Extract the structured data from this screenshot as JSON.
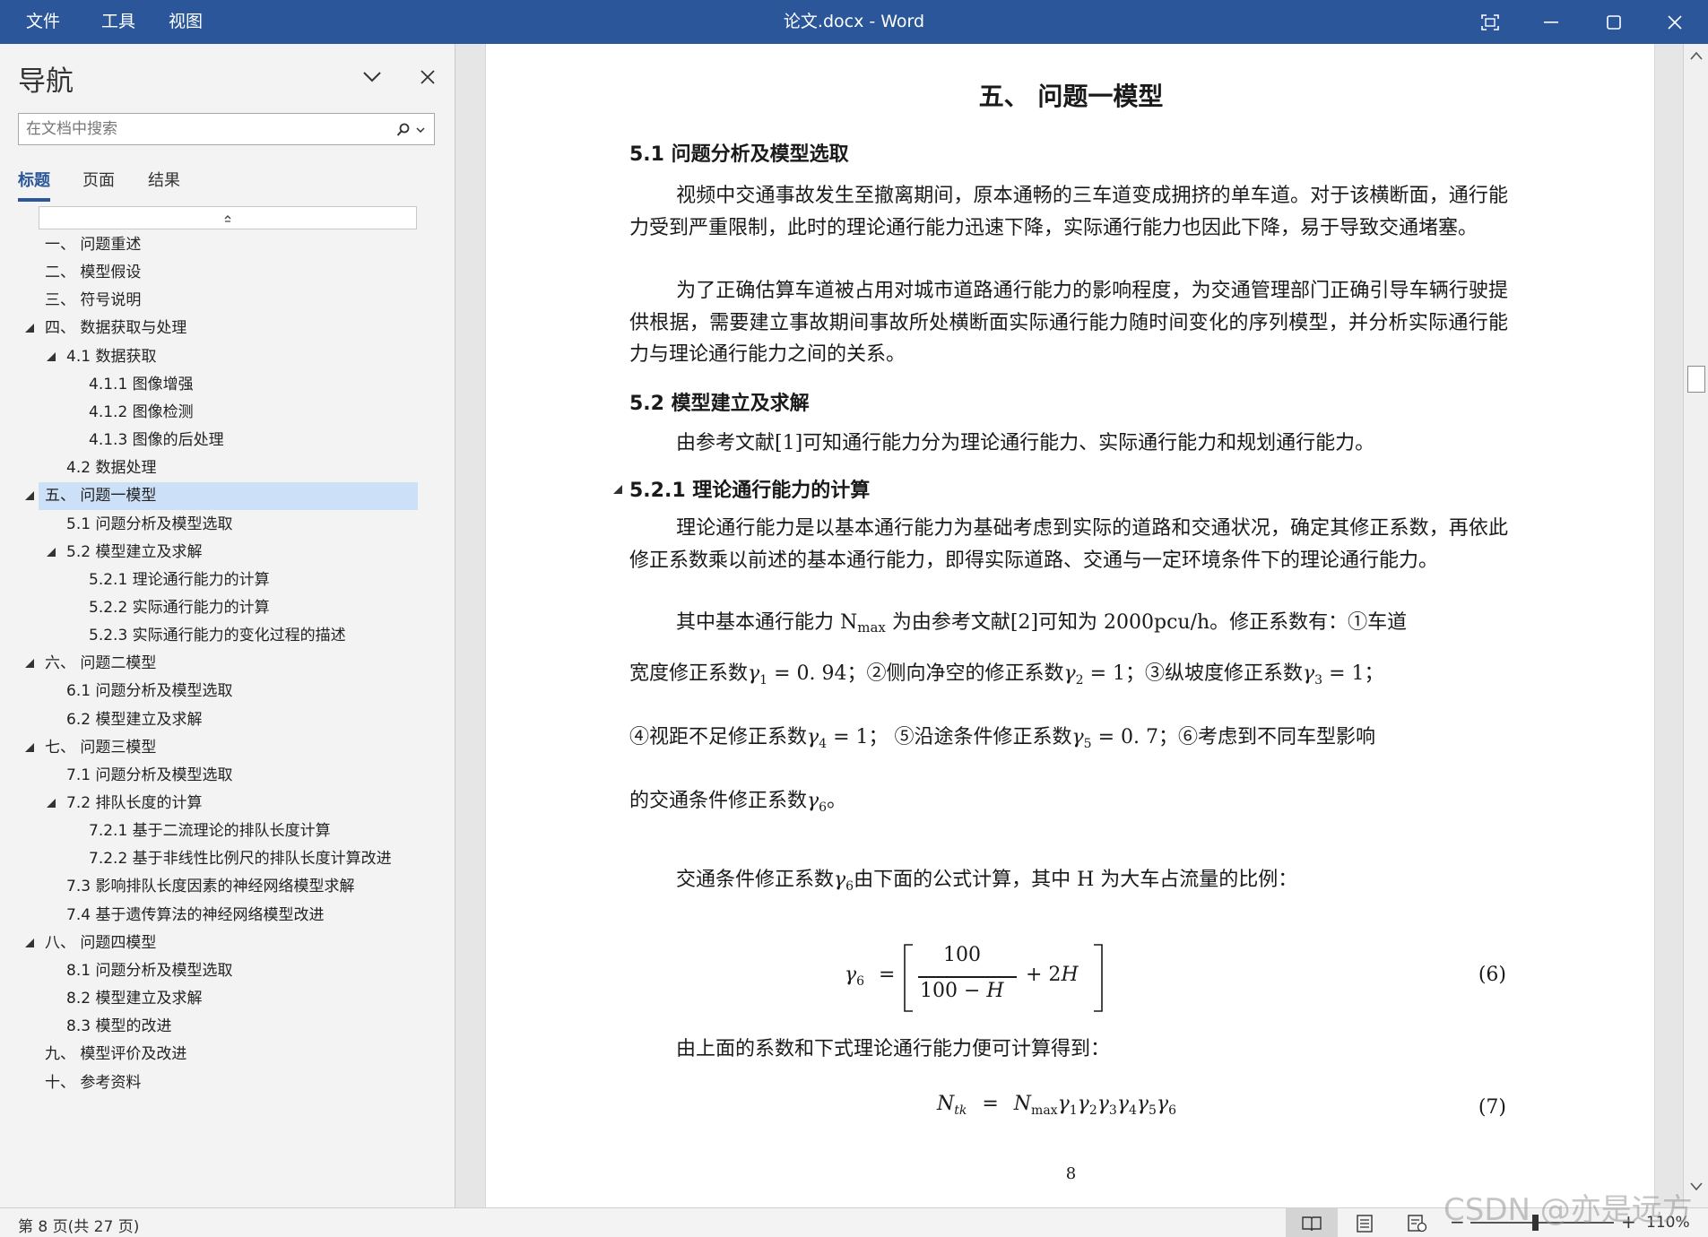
{
  "titlebar": {
    "menu": [
      "文件",
      "工具",
      "视图"
    ],
    "doc_title": "论文.docx - Word"
  },
  "nav": {
    "title": "导航",
    "search_placeholder": "在文档中搜索",
    "tabs": [
      "标题",
      "页面",
      "结果"
    ],
    "active_tab": "标题",
    "headings": [
      {
        "label": "一、 问题重述",
        "level": 1,
        "expandable": false
      },
      {
        "label": "二、 模型假设",
        "level": 1,
        "expandable": false
      },
      {
        "label": "三、 符号说明",
        "level": 1,
        "expandable": false
      },
      {
        "label": "四、 数据获取与处理",
        "level": 1,
        "expandable": true
      },
      {
        "label": "4.1 数据获取",
        "level": 2,
        "expandable": true
      },
      {
        "label": "4.1.1 图像增强",
        "level": 3,
        "expandable": false
      },
      {
        "label": "4.1.2 图像检测",
        "level": 3,
        "expandable": false
      },
      {
        "label": "4.1.3 图像的后处理",
        "level": 3,
        "expandable": false
      },
      {
        "label": "4.2 数据处理",
        "level": 2,
        "expandable": false
      },
      {
        "label": "五、 问题一模型",
        "level": 1,
        "expandable": true,
        "selected": true
      },
      {
        "label": "5.1 问题分析及模型选取",
        "level": 2,
        "expandable": false
      },
      {
        "label": "5.2 模型建立及求解",
        "level": 2,
        "expandable": true
      },
      {
        "label": "5.2.1 理论通行能力的计算",
        "level": 3,
        "expandable": false
      },
      {
        "label": "5.2.2 实际通行能力的计算",
        "level": 3,
        "expandable": false
      },
      {
        "label": "5.2.3 实际通行能力的变化过程的描述",
        "level": 3,
        "expandable": false
      },
      {
        "label": "六、 问题二模型",
        "level": 1,
        "expandable": true
      },
      {
        "label": "6.1 问题分析及模型选取",
        "level": 2,
        "expandable": false
      },
      {
        "label": "6.2 模型建立及求解",
        "level": 2,
        "expandable": false
      },
      {
        "label": "七、 问题三模型",
        "level": 1,
        "expandable": true
      },
      {
        "label": "7.1 问题分析及模型选取",
        "level": 2,
        "expandable": false
      },
      {
        "label": "7.2 排队长度的计算",
        "level": 2,
        "expandable": true
      },
      {
        "label": "7.2.1 基于二流理论的排队长度计算",
        "level": 3,
        "expandable": false
      },
      {
        "label": "7.2.2 基于非线性比例尺的排队长度计算改进",
        "level": 3,
        "expandable": false
      },
      {
        "label": "7.3 影响排队长度因素的神经网络模型求解",
        "level": 2,
        "expandable": false
      },
      {
        "label": "7.4 基于遗传算法的神经网络模型改进",
        "level": 2,
        "expandable": false
      },
      {
        "label": "八、 问题四模型",
        "level": 1,
        "expandable": true
      },
      {
        "label": "8.1 问题分析及模型选取",
        "level": 2,
        "expandable": false
      },
      {
        "label": "8.2 模型建立及求解",
        "level": 2,
        "expandable": false
      },
      {
        "label": "8.3 模型的改进",
        "level": 2,
        "expandable": false
      },
      {
        "label": "九、 模型评价及改进",
        "level": 1,
        "expandable": false
      },
      {
        "label": "十、 参考资料",
        "level": 1,
        "expandable": false
      }
    ]
  },
  "document": {
    "chapter_title": "五、 问题一模型",
    "sec_5_1": "5.1 问题分析及模型选取",
    "p1": "视频中交通事故发生至撤离期间，原本通畅的三车道变成拥挤的单车道。对于该横断面，通行能力受到严重限制，此时的理论通行能力迅速下降，实际通行能力也因此下降，易于导致交通堵塞。",
    "p2": "为了正确估算车道被占用对城市道路通行能力的影响程度，为交通管理部门正确引导车辆行驶提供根据，需要建立事故期间事故所处横断面实际通行能力随时间变化的序列模型，并分析实际通行能力与理论通行能力之间的关系。",
    "sec_5_2": "5.2 模型建立及求解",
    "p3": "由参考文献[1]可知通行能力分为理论通行能力、实际通行能力和规划通行能力。",
    "sec_5_2_1": "5.2.1 理论通行能力的计算",
    "p4": "理论通行能力是以基本通行能力为基础考虑到实际的道路和交通状况，确定其修正系数，再依此修正系数乘以前述的基本通行能力，即得实际道路、交通与一定环境条件下的理论通行能力。",
    "p5a": "其中基本通行能力 N",
    "p5_sub": "max",
    "p5b": " 为由参考文献[2]可知为 2000pcu/h。修正系数有：①车道",
    "m1a": "宽度修正系数",
    "m1b": " = 0. 94；②侧向净空的修正系数",
    "m1c": " = 1；③纵坡度修正系数",
    "m1d": " = 1；",
    "m2a": "④视距不足修正系数",
    "m2b": " = 1；  ⑤沿途条件修正系数",
    "m2c": " = 0. 7；⑥考虑到不同车型影响",
    "m3a": "的交通条件修正系数",
    "m3b": "。",
    "p6a": "交通条件修正系数",
    "p6b": "由下面的公式计算，其中 H 为大车占流量的比例：",
    "eq6_num": "100",
    "eq6_den_a": "100 − ",
    "eq6_den_b": "H",
    "eq6_plus": "+ 2",
    "eq6_H": "H",
    "eq6_label": "(6)",
    "p7": "由上面的系数和下式理论通行能力便可计算得到：",
    "eq7_label": "(7)",
    "gamma": "γ",
    "subs": [
      "1",
      "2",
      "3",
      "4",
      "5",
      "6"
    ],
    "N": "N",
    "tk": "tk",
    "max": "max",
    "eq_sign": "=",
    "page_number": "8"
  },
  "status": {
    "page_info": "第 8 页(共 27 页)",
    "zoom_minus": "−",
    "zoom_plus": "+",
    "zoom": "110%",
    "zoom_fraction": 0.45
  },
  "watermark": "CSDN @亦是远方",
  "colors": {
    "titlebar": "#2b579a",
    "selected_heading": "#cce0f7",
    "active_tab": "#2b579a"
  }
}
